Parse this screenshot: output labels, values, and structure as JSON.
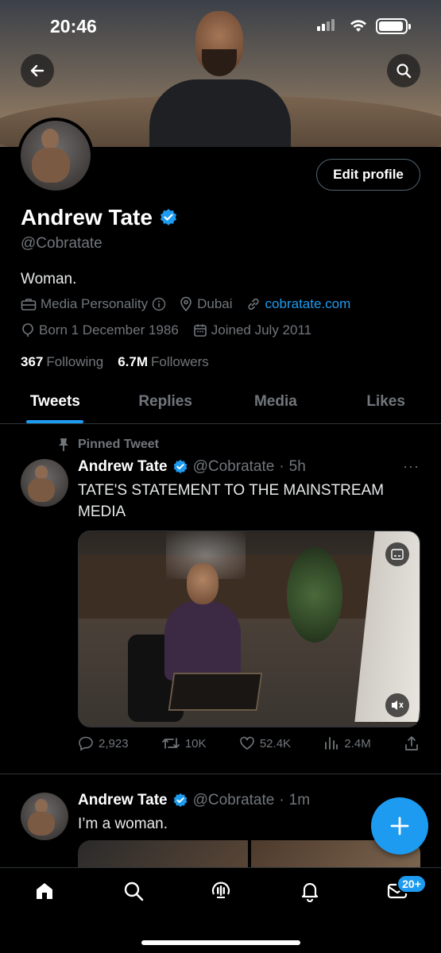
{
  "status_bar": {
    "time": "20:46"
  },
  "profile": {
    "name": "Andrew Tate",
    "handle": "@Cobratate",
    "edit_label": "Edit profile",
    "bio": "Woman.",
    "category": "Media Personality",
    "location": "Dubai",
    "website": "cobratate.com",
    "born": "Born 1 December 1986",
    "joined": "Joined July 2011",
    "following_count": "367",
    "following_label": "Following",
    "followers_count": "6.7M",
    "followers_label": "Followers"
  },
  "tabs": [
    {
      "label": "Tweets",
      "active": true
    },
    {
      "label": "Replies",
      "active": false
    },
    {
      "label": "Media",
      "active": false
    },
    {
      "label": "Likes",
      "active": false
    }
  ],
  "tweets": [
    {
      "pinned_label": "Pinned Tweet",
      "name": "Andrew Tate",
      "handle": "@Cobratate",
      "time": "5h",
      "text": "TATE'S STATEMENT TO THE MAINSTREAM MEDIA",
      "replies": "2,923",
      "retweets": "10K",
      "likes": "52.4K",
      "views": "2.4M"
    },
    {
      "name": "Andrew Tate",
      "handle": "@Cobratate",
      "time": "1m",
      "text": "I’m a woman."
    }
  ],
  "nav": {
    "messages_badge": "20+"
  },
  "colors": {
    "accent": "#1d9bf0",
    "background": "#000000",
    "muted": "#71767b"
  }
}
